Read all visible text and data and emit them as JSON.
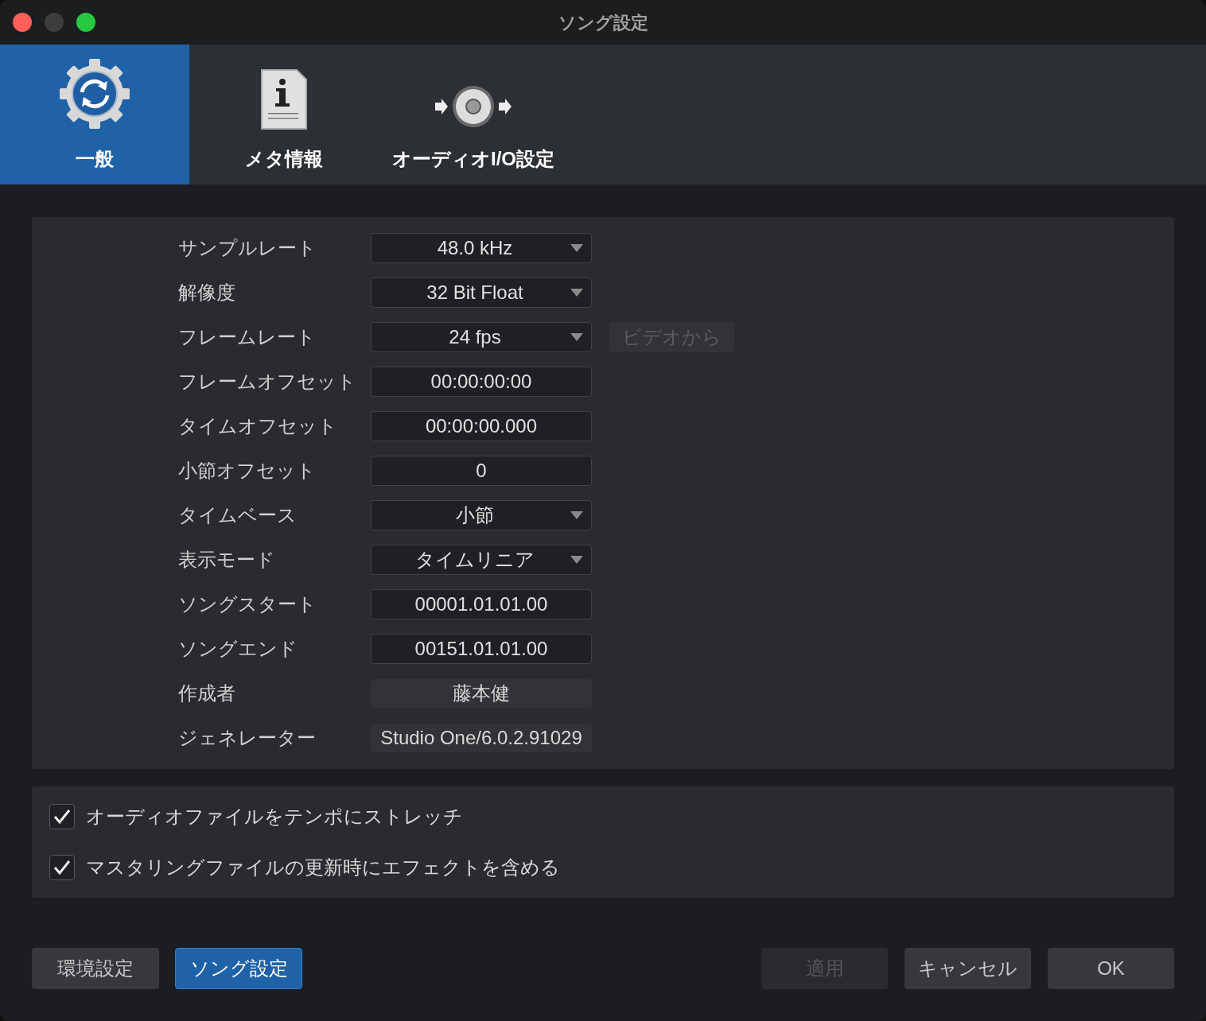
{
  "window": {
    "title": "ソング設定"
  },
  "tabs": [
    {
      "label": "一般",
      "selected": true
    },
    {
      "label": "メタ情報",
      "selected": false
    },
    {
      "label": "オーディオI/O設定",
      "selected": false
    }
  ],
  "settings": [
    {
      "label": "サンプルレート",
      "kind": "dropdown",
      "value": "48.0 kHz"
    },
    {
      "label": "解像度",
      "kind": "dropdown",
      "value": "32 Bit Float"
    },
    {
      "label": "フレームレート",
      "kind": "dropdown",
      "value": "24 fps",
      "side_button": {
        "label": "ビデオから",
        "disabled": true
      }
    },
    {
      "label": "フレームオフセット",
      "kind": "input",
      "value": "00:00:00:00"
    },
    {
      "label": "タイムオフセット",
      "kind": "input",
      "value": "00:00:00.000"
    },
    {
      "label": "小節オフセット",
      "kind": "input",
      "value": "0"
    },
    {
      "label": "タイムベース",
      "kind": "dropdown",
      "value": "小節"
    },
    {
      "label": "表示モード",
      "kind": "dropdown",
      "value": "タイムリニア"
    },
    {
      "label": "ソングスタート",
      "kind": "input",
      "value": "00001.01.01.00"
    },
    {
      "label": "ソングエンド",
      "kind": "input",
      "value": "00151.01.01.00"
    },
    {
      "label": "作成者",
      "kind": "readonly",
      "value": "藤本健"
    },
    {
      "label": "ジェネレーター",
      "kind": "readonly",
      "value": "Studio One/6.0.2.91029"
    }
  ],
  "options": [
    {
      "label": "オーディオファイルをテンポにストレッチ",
      "checked": true
    },
    {
      "label": "マスタリングファイルの更新時にエフェクトを含める",
      "checked": true
    }
  ],
  "footer_left": [
    {
      "label": "環境設定",
      "selected": false
    },
    {
      "label": "ソング設定",
      "selected": true
    }
  ],
  "footer_right": [
    {
      "label": "適用",
      "disabled": true
    },
    {
      "label": "キャンセル",
      "disabled": false
    },
    {
      "label": "OK",
      "disabled": false
    }
  ]
}
